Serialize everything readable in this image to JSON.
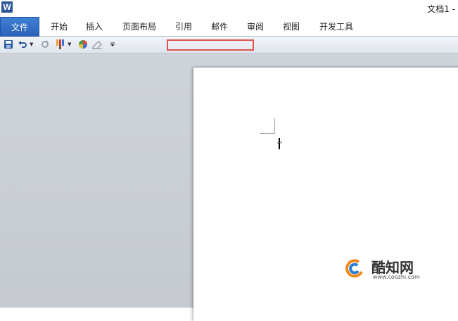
{
  "app": {
    "logo_letter": "W",
    "document_title": "文档1 -"
  },
  "ribbon": {
    "tabs": [
      {
        "label": "文件",
        "active": true
      },
      {
        "label": "开始"
      },
      {
        "label": "插入"
      },
      {
        "label": "页面布局"
      },
      {
        "label": "引用"
      },
      {
        "label": "邮件"
      },
      {
        "label": "审阅"
      },
      {
        "label": "视图"
      },
      {
        "label": "开发工具"
      }
    ]
  },
  "quick_access": {
    "icons": [
      "save-icon",
      "undo-icon",
      "redo-icon",
      "format-painter-icon",
      "color-palette-icon",
      "eraser-icon",
      "customize-dropdown-icon"
    ]
  },
  "watermark": {
    "title": "酷知网",
    "url": "www.coozhi.com"
  },
  "colors": {
    "file_tab": "#2a62b8",
    "highlight": "#e0524f",
    "workspace": "#cbd0d6",
    "watermark_orange": "#f08a1c",
    "watermark_blue": "#2a7fd4"
  }
}
